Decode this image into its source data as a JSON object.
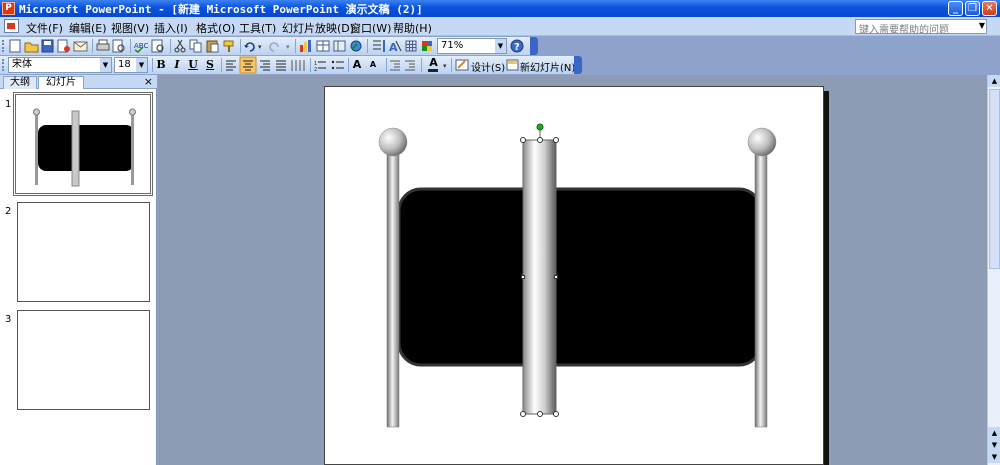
{
  "window": {
    "title": "Microsoft PowerPoint - [新建 Microsoft PowerPoint 演示文稿 (2)]",
    "app_icon_letter": "P",
    "minimize_glyph": "_",
    "restore_glyph": "❐",
    "close_glyph": "✕"
  },
  "menu": {
    "items": [
      "文件(F)",
      "编辑(E)",
      "视图(V)",
      "插入(I)",
      "格式(O)",
      "工具(T)",
      "幻灯片放映(D)",
      "窗口(W)",
      "帮助(H)"
    ],
    "help_placeholder": "键入需要帮助的问题"
  },
  "toolbar_standard": {
    "zoom": "71%"
  },
  "toolbar_format": {
    "font": "宋体",
    "size": "18",
    "bold": "B",
    "italic": "I",
    "underline": "U",
    "shadow": "S",
    "grow": "A",
    "shrink": "A",
    "font_color": "A",
    "design": "设计(S)",
    "new_slide": "新幻灯片(N)"
  },
  "left_pane": {
    "tabs": [
      "大纲",
      "幻灯片"
    ],
    "close": "×",
    "slides": [
      {
        "number": "1",
        "selected": true
      },
      {
        "number": "2",
        "selected": false
      },
      {
        "number": "3",
        "selected": false
      }
    ]
  },
  "colors": {
    "title_bar": "#0a52dc",
    "menu_bar": "#c6d9f4",
    "workspace": "#8d9bb4",
    "panel": "#000000",
    "selection_handle_rotate": "#22aa22"
  },
  "icons": [
    "new-icon",
    "open-icon",
    "save-icon",
    "permission-icon",
    "email-icon",
    "print-icon",
    "print-preview-icon",
    "spelling-icon",
    "research-icon",
    "cut-icon",
    "copy-icon",
    "paste-icon",
    "format-painter-icon",
    "undo-icon",
    "redo-icon",
    "insert-chart-icon",
    "insert-table-icon",
    "tables-borders-icon",
    "hyperlink-icon",
    "expand-all-icon",
    "show-formatting-icon",
    "grid-icon",
    "color-grayscale-icon",
    "help-icon"
  ]
}
